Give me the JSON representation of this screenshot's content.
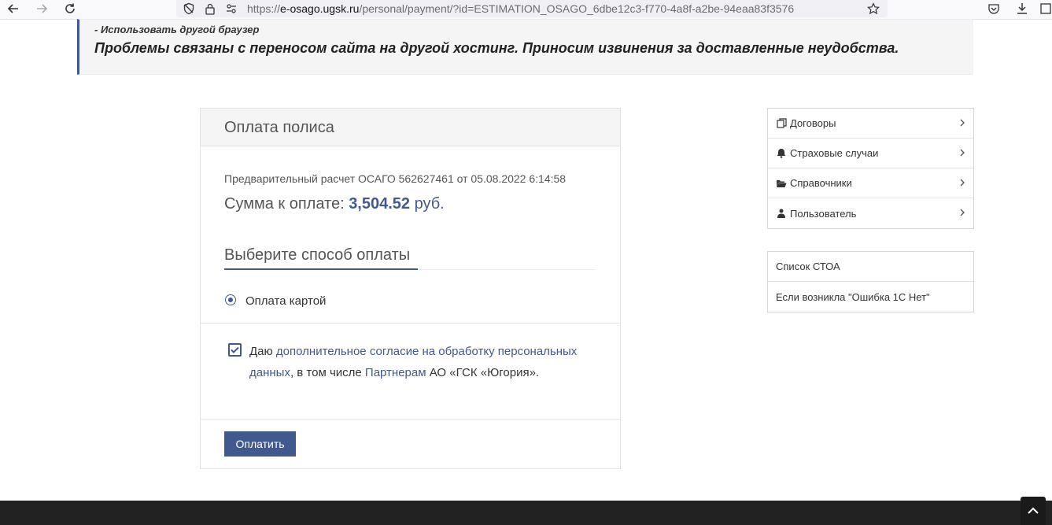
{
  "browser": {
    "url_host": "e-osago.ugsk.ru",
    "url_prefix": "https://",
    "url_path": "/personal/payment/?id=ESTIMATION_OSAGO_6dbe12c3-f770-4a8f-a2be-94eaa83f3576"
  },
  "notice": {
    "line1": "- Использовать другой браузер",
    "line2": "Проблемы связаны с переносом сайта на другой хостинг. Приносим извинения за доставленные неудобства."
  },
  "payment": {
    "title": "Оплата полиса",
    "estimate": "Предварительный расчет ОСАГО 562627461 от 05.08.2022 6:14:58",
    "sum_label": "Сумма к оплате: ",
    "sum_amount": "3,504.52",
    "sum_currency": " руб.",
    "method_heading": "Выберите способ оплаты",
    "method_option": "Оплата картой",
    "consent_prefix": "Даю ",
    "consent_link1": "дополнительное согласие на обработку персональных данных",
    "consent_mid": ", в том числе ",
    "consent_link2": "Партнерам",
    "consent_suffix": " АО «ГСК «Югория».",
    "pay_button": "Оплатить"
  },
  "side_menu": {
    "items": [
      {
        "label": "Договоры",
        "icon": "copy-icon"
      },
      {
        "label": "Страховые случаи",
        "icon": "bell-icon"
      },
      {
        "label": "Справочники",
        "icon": "folder-open-icon"
      },
      {
        "label": "Пользователь",
        "icon": "user-icon"
      }
    ]
  },
  "side_links": {
    "items": [
      "Список СТОА",
      "Если возникла \"Ошибка 1С Нет\""
    ]
  },
  "colors": {
    "accent": "#42598f",
    "footer_bg": "#222222",
    "notice_bg": "#f5f5f5"
  }
}
